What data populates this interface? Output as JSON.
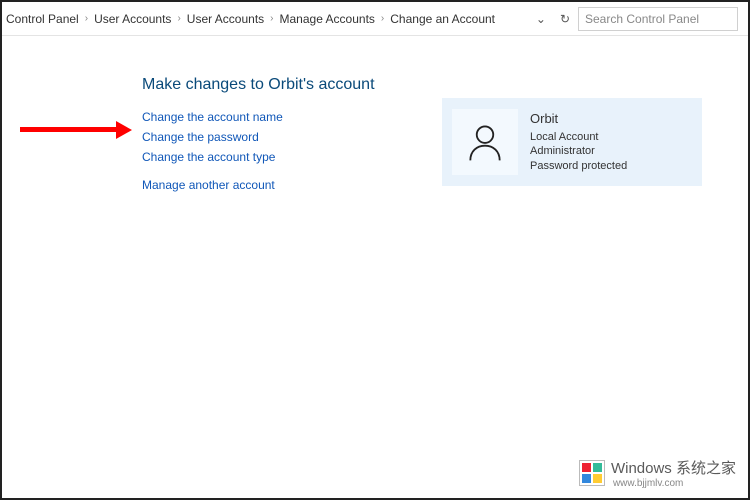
{
  "breadcrumbs": [
    "Control Panel",
    "User Accounts",
    "User Accounts",
    "Manage Accounts",
    "Change an Account"
  ],
  "search": {
    "placeholder": "Search Control Panel"
  },
  "heading": "Make changes to Orbit's account",
  "links": {
    "change_name": "Change the account name",
    "change_password": "Change the password",
    "change_type": "Change the account type",
    "manage_another": "Manage another account"
  },
  "account": {
    "name": "Orbit",
    "line1": "Local Account",
    "line2": "Administrator",
    "line3": "Password protected"
  },
  "watermark": {
    "brand": "Windows",
    "suffix": "系统之家",
    "url": "www.bjjmlv.com"
  }
}
